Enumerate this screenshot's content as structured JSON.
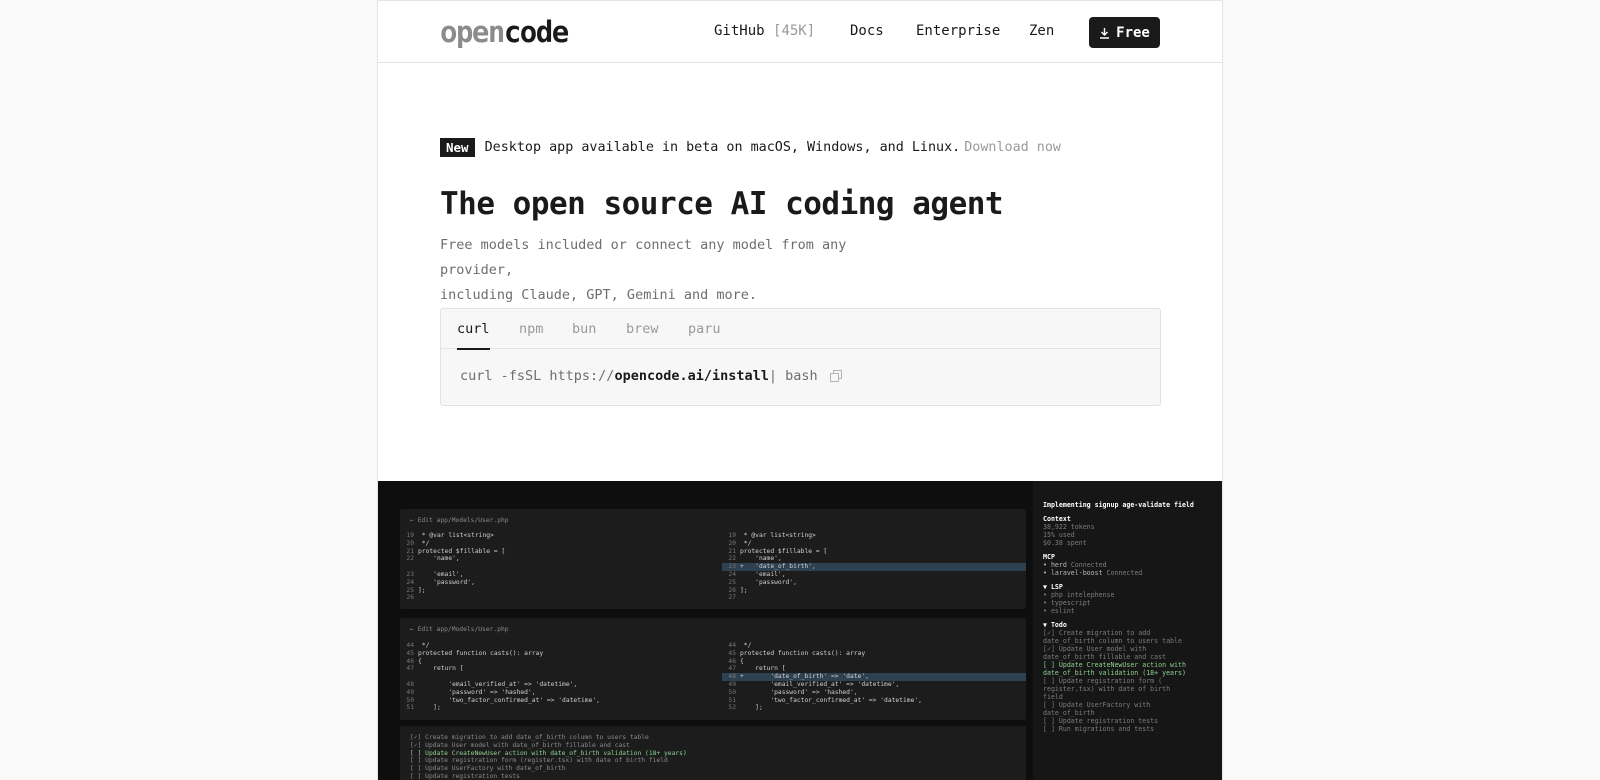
{
  "header": {
    "logo_a": "open",
    "logo_b": "code",
    "nav": [
      {
        "label": "GitHub",
        "extra": "[45K]"
      },
      {
        "label": "Docs"
      },
      {
        "label": "Enterprise"
      },
      {
        "label": "Zen"
      }
    ],
    "free_label": "Free"
  },
  "announce": {
    "badge": "New",
    "text": "Desktop app available in beta on macOS, Windows, and Linux.",
    "link": "Download now"
  },
  "hero": {
    "title": "The open source AI coding agent",
    "subtitle_line1": "Free models included or connect any model from any provider,",
    "subtitle_line2": "including Claude, GPT, Gemini and more."
  },
  "install": {
    "tabs": [
      "curl",
      "npm",
      "bun",
      "brew",
      "paru"
    ],
    "active_tab": "curl",
    "cmd_pre": "curl -fsSL https://",
    "cmd_strong": "opencode.ai/install",
    "cmd_post": " | bash"
  },
  "terminal": {
    "panel1": {
      "title": "← Edit app/Models/User.php",
      "left": [
        {
          "n": "19",
          "t": " * @var list<string>"
        },
        {
          "n": "20",
          "t": " */"
        },
        {
          "n": "21",
          "t": "protected $fillable = ["
        },
        {
          "n": "22",
          "t": "    'name',"
        },
        {
          "n": "",
          "t": ""
        },
        {
          "n": "23",
          "t": "    'email',"
        },
        {
          "n": "24",
          "t": "    'password',"
        },
        {
          "n": "25",
          "t": "];"
        },
        {
          "n": "26",
          "t": ""
        }
      ],
      "right": [
        {
          "n": "19",
          "t": " * @var list<string>"
        },
        {
          "n": "20",
          "t": " */"
        },
        {
          "n": "21",
          "t": "protected $fillable = ["
        },
        {
          "n": "22",
          "t": "    'name',"
        },
        {
          "n": "23",
          "t": "+   'date_of_birth',",
          "hl": true
        },
        {
          "n": "24",
          "t": "    'email',"
        },
        {
          "n": "25",
          "t": "    'password',"
        },
        {
          "n": "26",
          "t": "];"
        },
        {
          "n": "27",
          "t": ""
        }
      ]
    },
    "panel2": {
      "title": "← Edit app/Models/User.php",
      "left": [
        {
          "n": "44",
          "t": " */"
        },
        {
          "n": "45",
          "t": "protected function casts(): array"
        },
        {
          "n": "46",
          "t": "{"
        },
        {
          "n": "47",
          "t": "    return ["
        },
        {
          "n": "",
          "t": ""
        },
        {
          "n": "48",
          "t": "        'email_verified_at' => 'datetime',"
        },
        {
          "n": "49",
          "t": "        'password' => 'hashed',"
        },
        {
          "n": "50",
          "t": "        'two_factor_confirmed_at' => 'datetime',"
        },
        {
          "n": "51",
          "t": "    ];"
        }
      ],
      "right": [
        {
          "n": "44",
          "t": " */"
        },
        {
          "n": "45",
          "t": "protected function casts(): array"
        },
        {
          "n": "46",
          "t": "{"
        },
        {
          "n": "47",
          "t": "    return ["
        },
        {
          "n": "48",
          "t": "+       'date_of_birth' => 'date',",
          "hl": true
        },
        {
          "n": "49",
          "t": "        'email_verified_at' => 'datetime',"
        },
        {
          "n": "50",
          "t": "        'password' => 'hashed',"
        },
        {
          "n": "51",
          "t": "        'two_factor_confirmed_at' => 'datetime',"
        },
        {
          "n": "52",
          "t": "    ];"
        }
      ]
    },
    "todos": [
      {
        "t": "[✓] Create migration to add date_of_birth column to users table"
      },
      {
        "t": "[✓] Update User model with date_of_birth fillable and cast"
      },
      {
        "t": "[ ] Update CreateNewUser action with date_of_birth validation (18+ years)",
        "green": true
      },
      {
        "t": "[ ] Update registration form (register.tsx) with date of birth field"
      },
      {
        "t": "[ ] Update UserFactory with date_of_birth"
      },
      {
        "t": "[ ] Update registration tests"
      }
    ],
    "sidebar": {
      "title": "Implementing signup age-validate field",
      "context_hd": "Context",
      "context": [
        "38,922 tokens",
        "15% used",
        "$0.38 spent"
      ],
      "mcp_hd": "MCP",
      "mcp": [
        {
          "name": "• herd",
          "status": "Connected"
        },
        {
          "name": "• laravel-boost",
          "status": "Connected"
        }
      ],
      "lsp_hd": "▼ LSP",
      "lsp": [
        "• php intelephense",
        "• typescript",
        "• eslint"
      ],
      "todo_hd": "▼ Todo",
      "todo": [
        {
          "t": "[✓] Create migration to add"
        },
        {
          "t": "date_of_birth column to users table"
        },
        {
          "t": "[✓] Update User model with"
        },
        {
          "t": "date_of_birth fillable and cast"
        },
        {
          "t": "[ ] Update CreateNewUser action with",
          "green": true
        },
        {
          "t": "date_of_birth validation (18+ years)",
          "green": true
        },
        {
          "t": "[ ] Update registration form ("
        },
        {
          "t": "register.tsx) with date of birth"
        },
        {
          "t": "field"
        },
        {
          "t": "[ ] Update UserFactory with"
        },
        {
          "t": "date_of_birth"
        },
        {
          "t": "[ ] Update registration tests"
        },
        {
          "t": "[ ] Run migrations and tests"
        }
      ]
    }
  },
  "colors": {
    "accent": "#1a1a1a",
    "muted": "#9a9a9a",
    "diff_highlight": "#2e4151",
    "todo_active": "#8fd18f"
  }
}
